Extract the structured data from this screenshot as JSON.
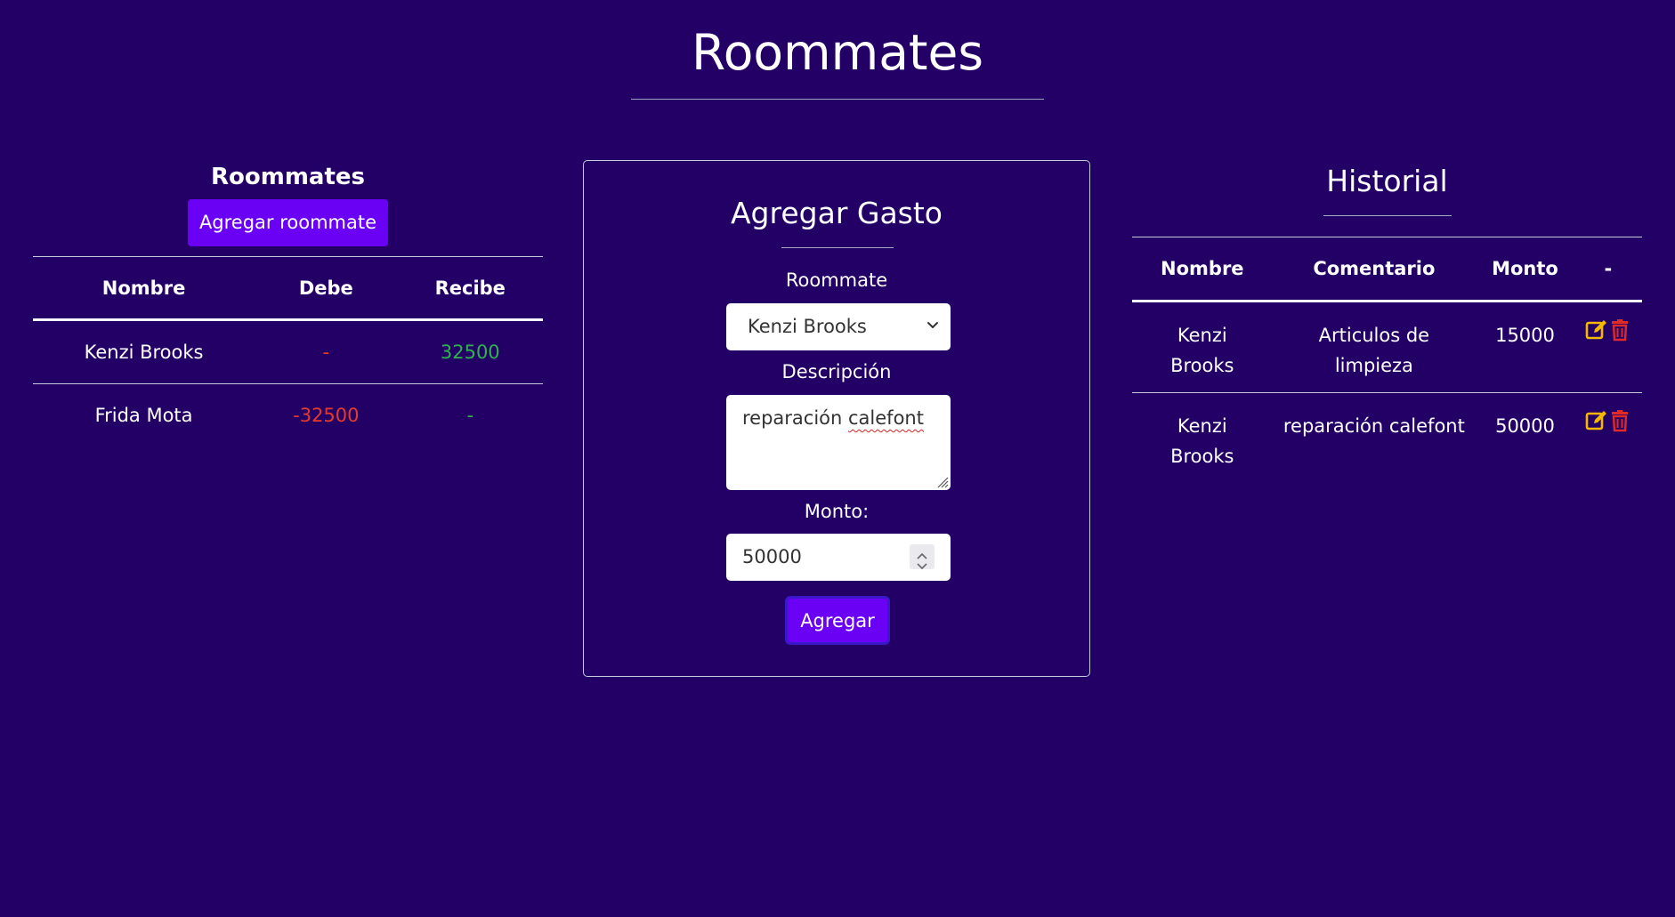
{
  "header": {
    "title": "Roommates"
  },
  "roommates_panel": {
    "heading": "Roommates",
    "add_button_label": "Agregar roommate",
    "columns": [
      "Nombre",
      "Debe",
      "Recibe"
    ],
    "rows": [
      {
        "nombre": "Kenzi Brooks",
        "debe": "-",
        "recibe": "32500"
      },
      {
        "nombre": "Frida Mota",
        "debe": "-32500",
        "recibe": "-"
      }
    ]
  },
  "expense_form": {
    "title": "Agregar Gasto",
    "roommate_label": "Roommate",
    "roommate_selected": "Kenzi Brooks",
    "descripcion_label": "Descripción",
    "descripcion_value_part1": "reparación ",
    "descripcion_value_part2": "calefont",
    "monto_label": "Monto:",
    "monto_value": "50000",
    "submit_label": "Agregar"
  },
  "historial": {
    "heading": "Historial",
    "columns": [
      "Nombre",
      "Comentario",
      "Monto",
      "-"
    ],
    "rows": [
      {
        "nombre_1": "Kenzi",
        "nombre_2": "Brooks",
        "comentario_1": "Articulos de",
        "comentario_2": "limpieza",
        "monto": "15000"
      },
      {
        "nombre_1": "Kenzi",
        "nombre_2": "Brooks",
        "comentario_1": "reparación calefont",
        "comentario_2": "",
        "monto": "50000"
      }
    ]
  },
  "colors": {
    "background": "#230066",
    "accent": "#6a00f4",
    "negative": "#e43a2b",
    "positive": "#2fb34c",
    "edit_icon": "#f5b800",
    "delete_icon": "#e02a2a"
  },
  "icons": {
    "edit": "edit-icon",
    "delete": "trash-icon",
    "select_chevron": "chevron-down-icon"
  }
}
